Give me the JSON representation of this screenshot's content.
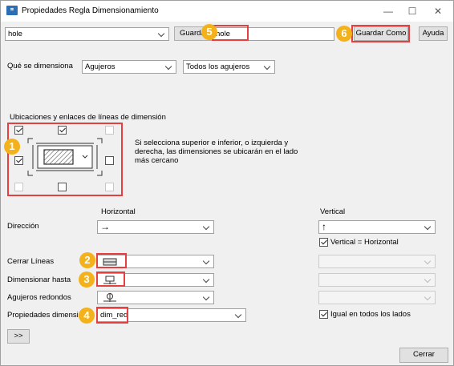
{
  "window": {
    "title": "Propiedades Regla Dimensionamiento",
    "minimize": "—",
    "maximize": "☐",
    "close": "✕"
  },
  "toolbar": {
    "rule_value": "hole",
    "save_label": "Guardar",
    "name_value": "hole",
    "save_as_label": "Guardar Como",
    "help_label": "Ayuda"
  },
  "what": {
    "label": "Qué se dimensiona",
    "object_value": "Agujeros",
    "scope_value": "Todos los agujeros"
  },
  "locations": {
    "title": "Ubicaciones y enlaces de líneas de dimensión",
    "hint": "Si selecciona superior e inferior, o izquierda y derecha, las dimensiones se ubicarán en el lado más cercano",
    "checks": {
      "top_left": true,
      "top_center": true,
      "top_right": false,
      "mid_left": true,
      "mid_right": false,
      "bottom_left": false,
      "bottom_center": false,
      "bottom_right": false
    }
  },
  "direction": {
    "label": "Dirección",
    "horizontal_header": "Horizontal",
    "vertical_header": "Vertical",
    "horizontal_value": "→",
    "vertical_value": "↑",
    "vertical_equals_label": "Vertical = Horizontal"
  },
  "rows": {
    "close_lines": "Cerrar Líneas",
    "dimension_to": "Dimensionar hasta",
    "round_holes": "Agujeros redondos",
    "dim_props": "Propiedades dimensi",
    "dim_props_value": "dim_red",
    "same_all_sides": "Igual en todos los lados"
  },
  "badges": [
    "1",
    "2",
    "3",
    "4",
    "5",
    "6"
  ],
  "expand_label": ">>",
  "close_button": "Cerrar",
  "colors": {
    "highlight": "#e5403f",
    "badge": "#f3b21b"
  }
}
